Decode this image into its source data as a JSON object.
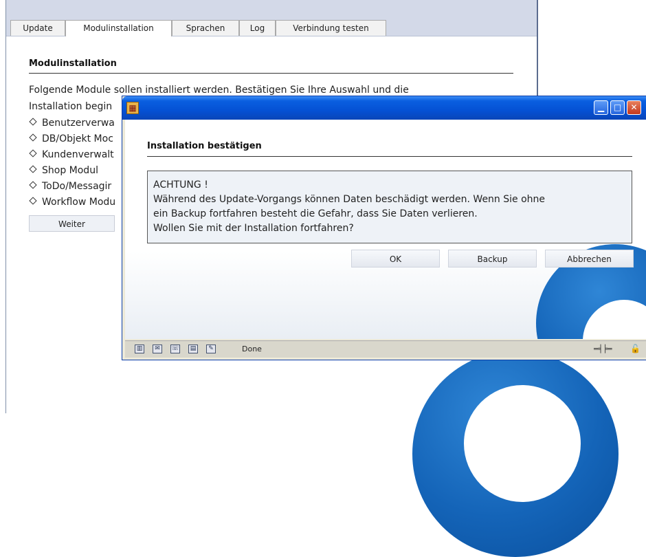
{
  "colors": {
    "title_blue": "#0551d4",
    "tab_bar": "#d3d9e8",
    "logo_blue": "#1464b8"
  },
  "tabs": [
    {
      "label": "Update"
    },
    {
      "label": "Modulinstallation"
    },
    {
      "label": "Sprachen"
    },
    {
      "label": "Log"
    },
    {
      "label": "Verbindung testen"
    }
  ],
  "page": {
    "heading": "Modulinstallation",
    "intro_line1": "Folgende Module sollen installiert werden. Bestätigen Sie Ihre Auswahl und die",
    "intro_line2": "Installation begin",
    "modules": [
      {
        "label": "Benutzerverwa"
      },
      {
        "label": "DB/Objekt Moc"
      },
      {
        "label": "Kundenverwalt"
      },
      {
        "label": "Shop Modul"
      },
      {
        "label": "ToDo/Messagir"
      },
      {
        "label": "Workflow Modu"
      }
    ],
    "next_button": "Weiter"
  },
  "dialog": {
    "app_icon": "app-icon",
    "heading": "Installation bestätigen",
    "message": {
      "line1": "ACHTUNG !",
      "line2": "Während des Update-Vorgangs können Daten beschädigt werden. Wenn Sie ohne",
      "line3": "ein Backup fortfahren besteht die Gefahr, dass Sie Daten verlieren.",
      "line4": "Wollen Sie mit der Installation fortfahren?"
    },
    "buttons": {
      "ok": "OK",
      "backup": "Backup",
      "cancel": "Abbrechen"
    },
    "window_controls": {
      "minimize": "minimize-icon",
      "maximize": "maximize-icon",
      "close": "close-icon"
    },
    "status": {
      "text": "Done",
      "icons": [
        "navigator-icon",
        "mail-icon",
        "chat-icon",
        "composer-icon",
        "edit-icon"
      ],
      "right_icons": [
        "connection-icon",
        "lock-icon"
      ]
    }
  }
}
